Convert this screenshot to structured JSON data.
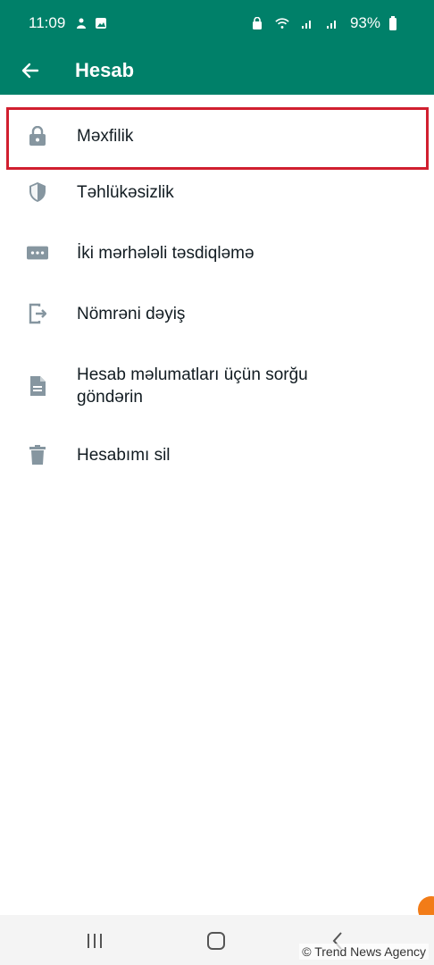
{
  "status_bar": {
    "time": "11:09",
    "battery": "93%",
    "icons": [
      "notification-icon",
      "gallery-icon",
      "lock-icon",
      "wifi-icon",
      "signal-icon",
      "signal-icon",
      "battery-icon"
    ]
  },
  "header": {
    "title": "Hesab",
    "back_icon": "arrow-left-icon"
  },
  "menu": {
    "items": [
      {
        "label": "Məxfilik",
        "icon": "lock-icon"
      },
      {
        "label": "Təhlükəsizlik",
        "icon": "shield-icon"
      },
      {
        "label": "İki mərhələli təsdiqləmə",
        "icon": "password-dots-icon"
      },
      {
        "label": "Nömrəni dəyiş",
        "icon": "phone-change-icon"
      },
      {
        "label": "Hesab məlumatları üçün sorğu göndərin",
        "icon": "document-icon"
      },
      {
        "label": "Hesabımı sil",
        "icon": "trash-icon"
      }
    ],
    "highlighted_index": 0
  },
  "watermark": "© Trend News Agency",
  "colors": {
    "header": "#008069",
    "highlight": "#d11f2f",
    "icon": "#8696a0",
    "text": "#111b21"
  }
}
